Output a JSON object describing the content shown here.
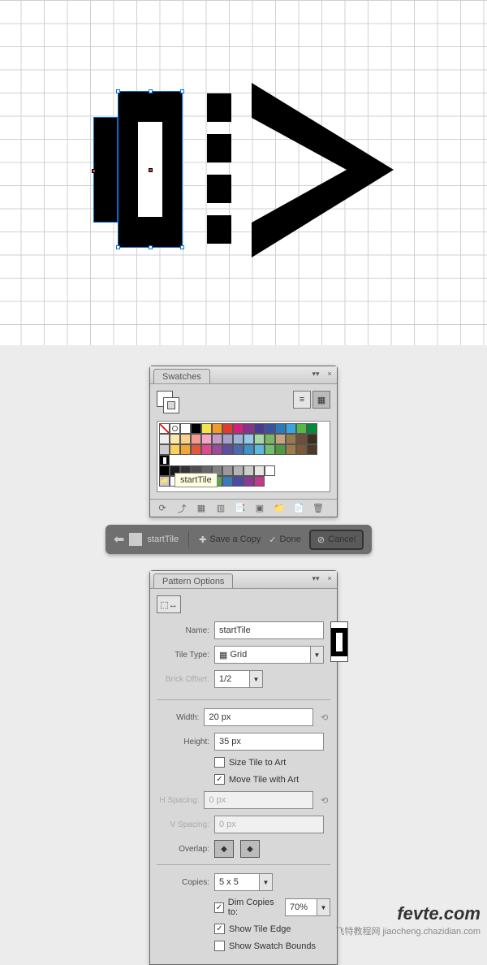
{
  "swatches": {
    "title": "Swatches",
    "tooltip": "startTile",
    "icons": {
      "list": "≡",
      "grid": "▦",
      "menu": "▾▾",
      "close": "×"
    },
    "footer": [
      "⟳",
      "⤴",
      "▦",
      "▥",
      "📑",
      "▣",
      "📁",
      "📄",
      "🗑"
    ],
    "row1": [
      "none",
      "reg",
      "#ffffff",
      "#000000",
      "#f7e24a",
      "#f49b27",
      "#e23a2b",
      "#d61f7f",
      "#8d2f8e",
      "#4b3a91",
      "#3853a4",
      "#2a7bbd",
      "#37a6de",
      "#56b848",
      "#008b3a"
    ],
    "row2": [
      "#eee",
      "#fce9a8",
      "#fbd08a",
      "#f39b8e",
      "#f3a6c8",
      "#c59bc7",
      "#a6a0cb",
      "#9fb4d9",
      "#95c8eb",
      "#a4d9a6",
      "#7bb662",
      "#c4a484",
      "#997950",
      "#6d4f3a",
      "#3b2e1f"
    ],
    "row3": [
      "#ccc",
      "#f7d25c",
      "#f1a638",
      "#e2593a",
      "#df4a8f",
      "#9a4b9c",
      "#5f4ea0",
      "#4a6bb1",
      "#3f92cc",
      "#5bb8de",
      "#6fbf6f",
      "#4f9a3f",
      "#a07a4a",
      "#7d5a34",
      "#4e3a24"
    ],
    "pattern_row": [
      "startTile-pattern"
    ],
    "gray_row": [
      "#000",
      "#1a1a1a",
      "#333",
      "#4d4d4d",
      "#666",
      "#808080",
      "#999",
      "#b3b3b3",
      "#ccc",
      "#e6e6e6",
      "#fff"
    ],
    "bottom_row": [
      "#fff",
      "#d13434",
      "#e07b1f",
      "#e8c23a",
      "#5aa84a",
      "#3a7bbd",
      "#4a4aa8",
      "#8b3a9a",
      "#c43a8b"
    ]
  },
  "editbar": {
    "pattern_name": "startTile",
    "save": "Save a Copy",
    "done": "Done",
    "cancel": "Cancel"
  },
  "pattern": {
    "title": "Pattern Options",
    "name_label": "Name:",
    "name": "startTile",
    "tiletype_label": "Tile Type:",
    "tiletype": "Grid",
    "brickoffset_label": "Brick Offset:",
    "brickoffset": "1/2",
    "width_label": "Width:",
    "width": "20 px",
    "height_label": "Height:",
    "height": "35 px",
    "size_tile": "Size Tile to Art",
    "move_tile": "Move Tile with Art",
    "hspacing_label": "H Spacing:",
    "hspacing": "0 px",
    "vspacing_label": "V Spacing:",
    "vspacing": "0 px",
    "overlap_label": "Overlap:",
    "copies_label": "Copies:",
    "copies": "5 x 5",
    "dim": "Dim Copies to:",
    "dim_value": "70%",
    "show_edge": "Show Tile Edge",
    "show_swatch": "Show Swatch Bounds"
  },
  "watermark": {
    "l1": "fevte.com",
    "l2": "飞特教程网 jiaocheng.chazidian.com"
  }
}
